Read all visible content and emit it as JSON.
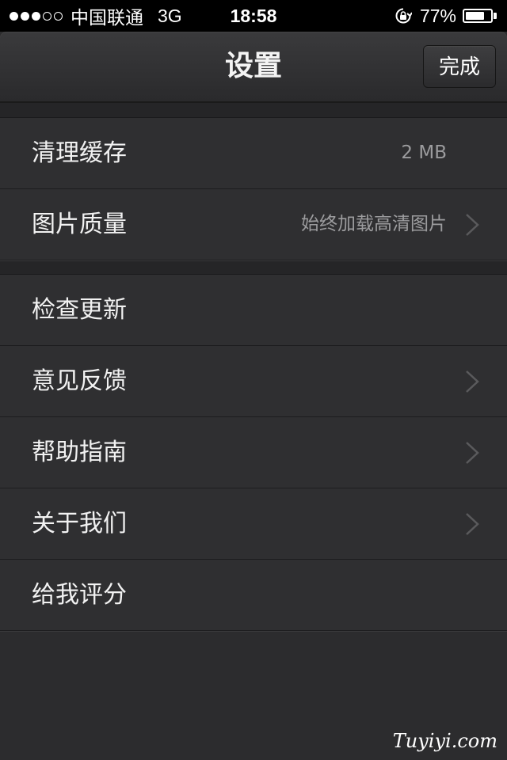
{
  "status_bar": {
    "signal_dots_filled": 3,
    "signal_dots_total": 5,
    "carrier": "中国联通",
    "network": "3G",
    "time": "18:58",
    "rotation_lock_icon": "rotation-lock-icon",
    "battery_percent": "77%",
    "battery_level": 0.77
  },
  "nav": {
    "title": "设置",
    "done_label": "完成"
  },
  "section1": [
    {
      "label": "清理缓存",
      "value": "2 MB",
      "chevron": false
    },
    {
      "label": "图片质量",
      "value": "始终加载高清图片",
      "chevron": true
    }
  ],
  "section2": [
    {
      "label": "检查更新",
      "chevron": false
    },
    {
      "label": "意见反馈",
      "chevron": true
    },
    {
      "label": "帮助指南",
      "chevron": true
    },
    {
      "label": "关于我们",
      "chevron": true
    },
    {
      "label": "给我评分",
      "chevron": false
    }
  ],
  "watermark": "Tuyiyi.com",
  "colors": {
    "background": "#2c2c2e",
    "text": "#f2f2f2",
    "secondary_text": "#9c9c9e"
  }
}
